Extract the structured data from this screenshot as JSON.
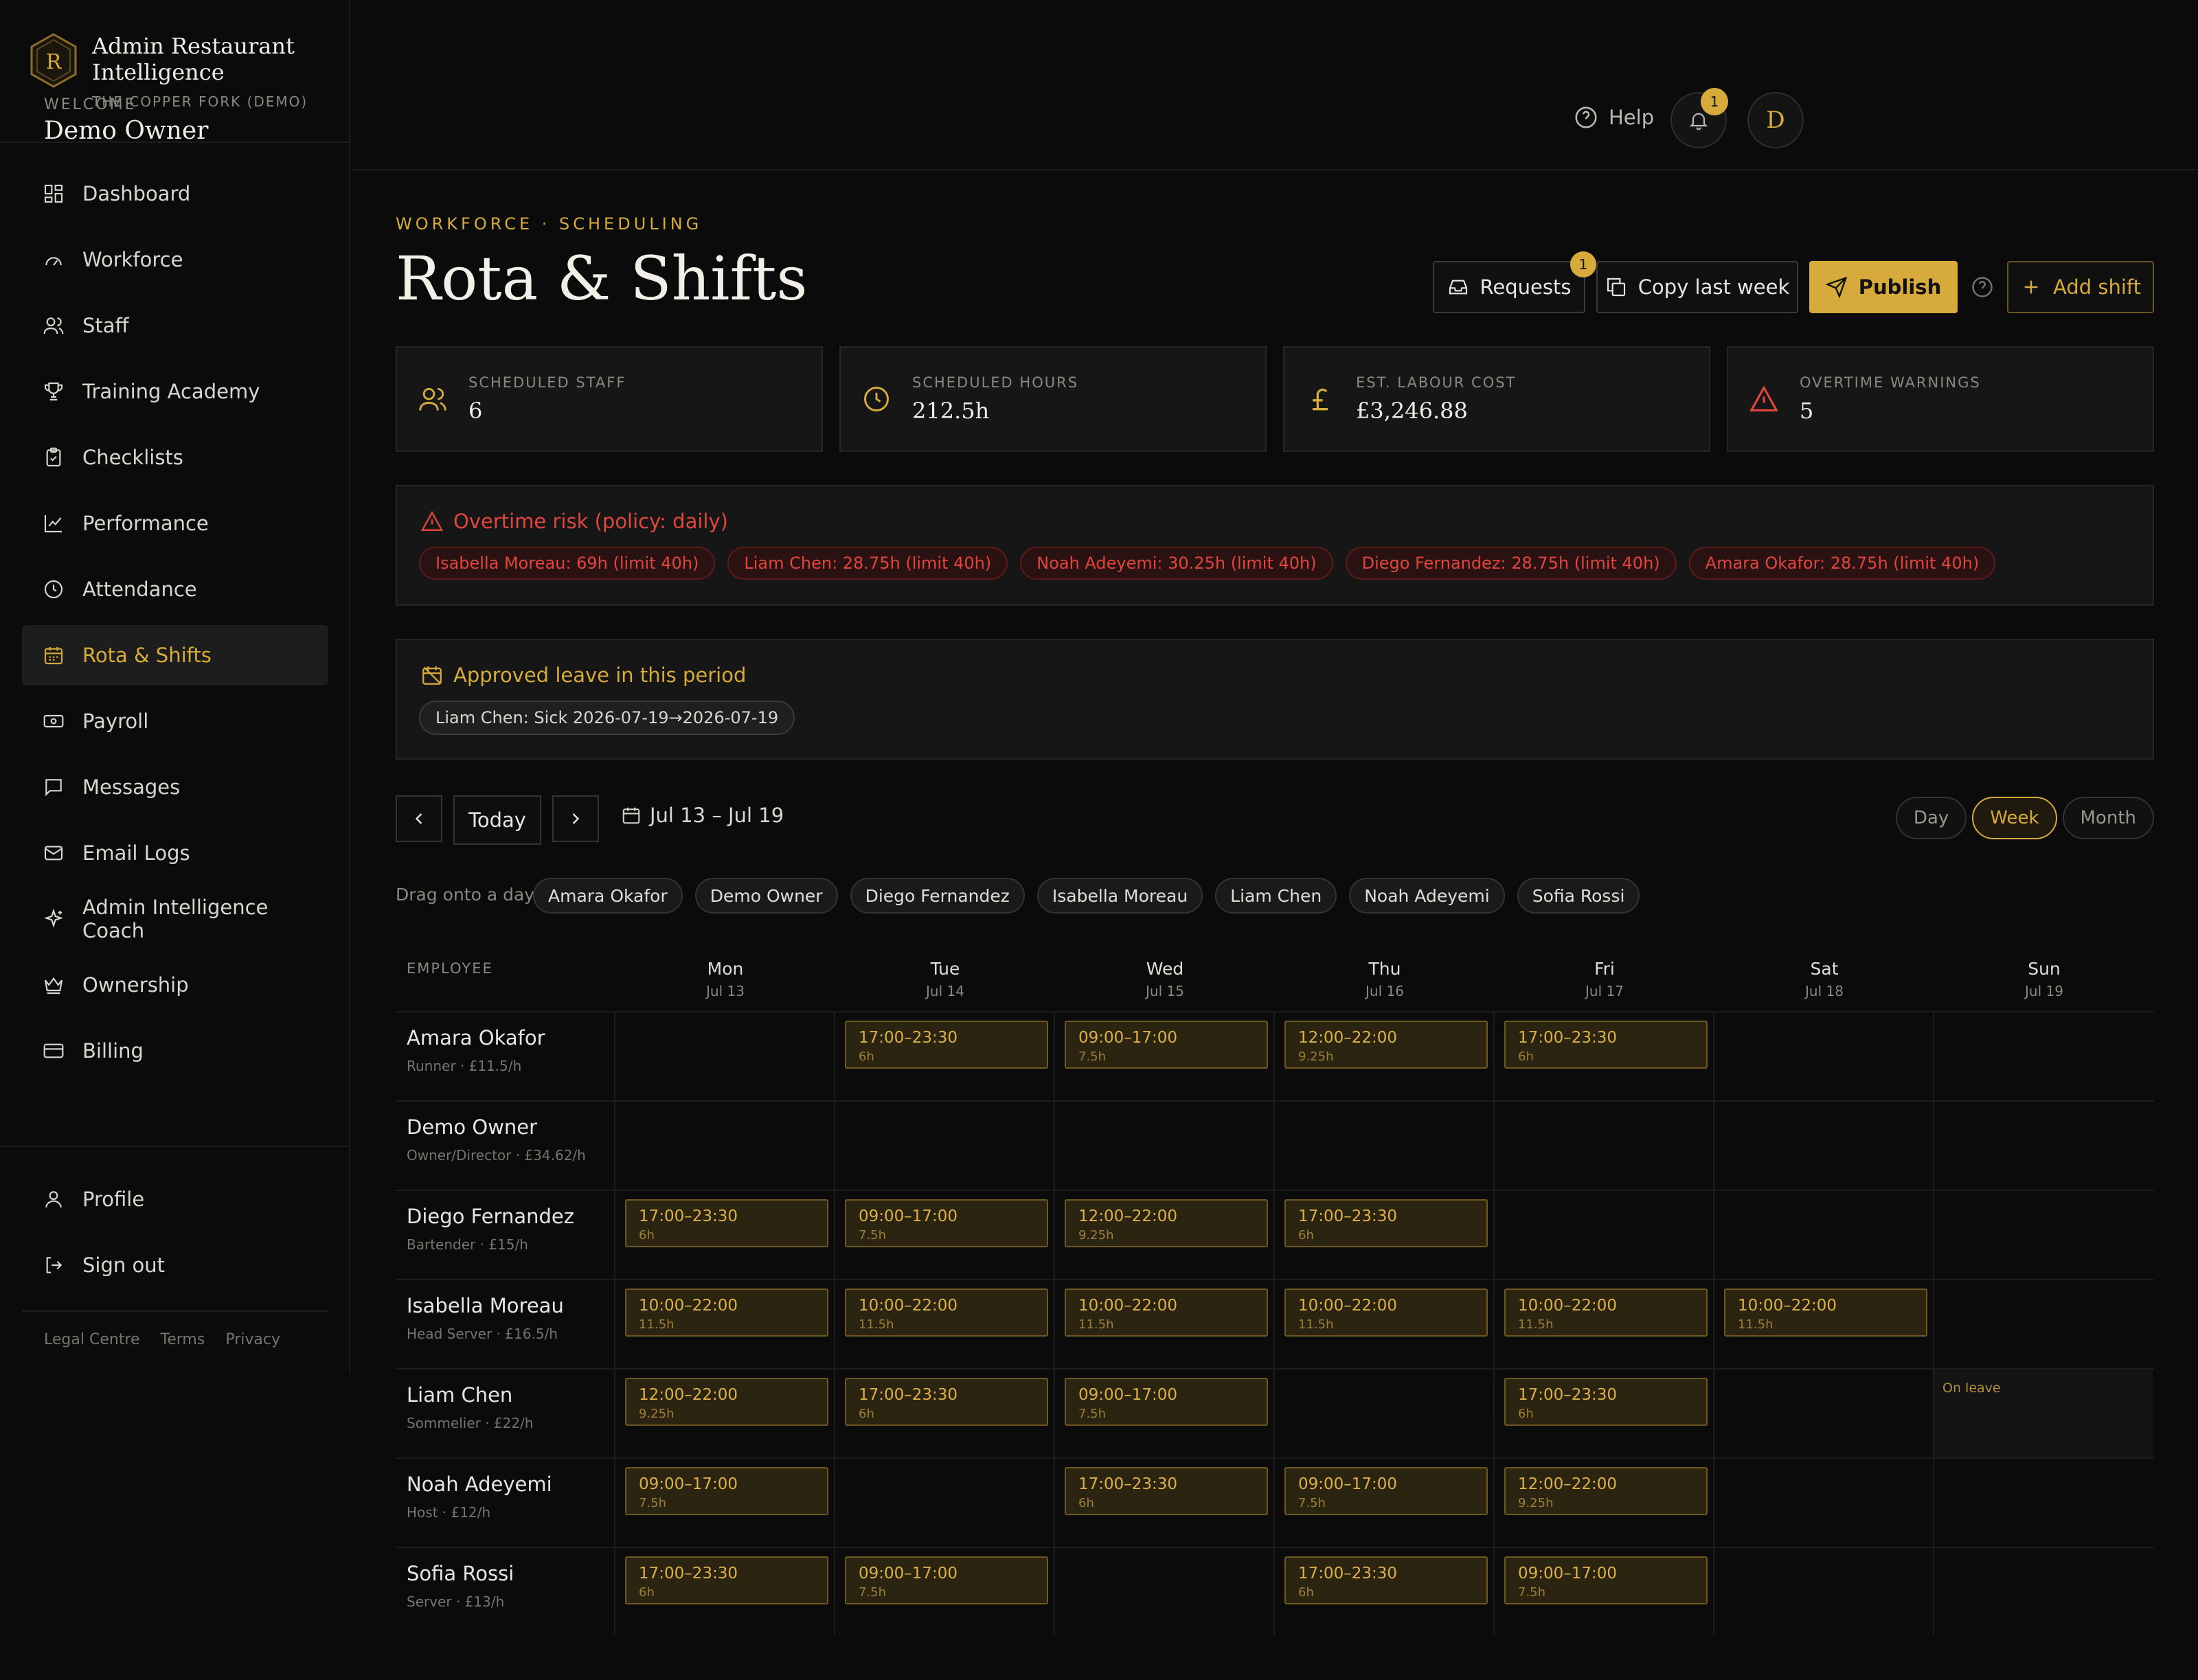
{
  "brand": {
    "title": "Admin Restaurant Intelligence",
    "subtitle": "THE COPPER FORK (DEMO)"
  },
  "nav": [
    {
      "label": "Dashboard",
      "icon": "dashboard-icon"
    },
    {
      "label": "Workforce",
      "icon": "gauge-icon"
    },
    {
      "label": "Staff",
      "icon": "users-icon"
    },
    {
      "label": "Training Academy",
      "icon": "trophy-icon"
    },
    {
      "label": "Checklists",
      "icon": "clipboard-check-icon"
    },
    {
      "label": "Performance",
      "icon": "line-chart-icon"
    },
    {
      "label": "Attendance",
      "icon": "clock-icon"
    },
    {
      "label": "Rota & Shifts",
      "icon": "calendar-icon",
      "active": true
    },
    {
      "label": "Payroll",
      "icon": "banknote-icon"
    },
    {
      "label": "Messages",
      "icon": "message-icon"
    },
    {
      "label": "Email Logs",
      "icon": "mail-icon"
    },
    {
      "label": "Admin Intelligence Coach",
      "icon": "sparkles-icon"
    },
    {
      "label": "Ownership",
      "icon": "crown-icon"
    },
    {
      "label": "Billing",
      "icon": "credit-card-icon"
    }
  ],
  "nav_bottom": [
    {
      "label": "Profile",
      "icon": "user-icon"
    },
    {
      "label": "Sign out",
      "icon": "log-out-icon"
    }
  ],
  "legal": {
    "centre": "Legal Centre",
    "terms": "Terms",
    "privacy": "Privacy"
  },
  "header": {
    "welcome_label": "WELCOME",
    "welcome_name": "Demo Owner",
    "help": "Help",
    "notif_count": "1",
    "avatar_initial": "D"
  },
  "page": {
    "eyebrow": "WORKFORCE · SCHEDULING",
    "title": "Rota & Shifts"
  },
  "actions": {
    "requests": "Requests",
    "requests_badge": "1",
    "copy": "Copy last week",
    "publish": "Publish",
    "add_shift": "Add shift"
  },
  "stats": [
    {
      "label": "SCHEDULED STAFF",
      "value": "6",
      "icon": "users-icon"
    },
    {
      "label": "SCHEDULED HOURS",
      "value": "212.5h",
      "icon": "clock-icon"
    },
    {
      "label": "EST. LABOUR COST",
      "value": "£3,246.88",
      "icon": "pound-icon"
    },
    {
      "label": "OVERTIME WARNINGS",
      "value": "5",
      "icon": "alert-triangle-icon"
    }
  ],
  "overtime": {
    "title": "Overtime risk (policy: daily)",
    "items": [
      "Isabella Moreau: 69h (limit 40h)",
      "Liam Chen: 28.75h (limit 40h)",
      "Noah Adeyemi: 30.25h (limit 40h)",
      "Diego Fernandez: 28.75h (limit 40h)",
      "Amara Okafor: 28.75h (limit 40h)"
    ]
  },
  "leave": {
    "title": "Approved leave in this period",
    "items": [
      "Liam Chen: Sick 2026-07-19→2026-07-19"
    ]
  },
  "calendar": {
    "today": "Today",
    "range": "Jul 13 – Jul 19",
    "views": [
      "Day",
      "Week",
      "Month"
    ],
    "active_view": "Week",
    "drag_label": "Drag onto a day:",
    "drag_people": [
      "Amara Okafor",
      "Demo Owner",
      "Diego Fernandez",
      "Isabella Moreau",
      "Liam Chen",
      "Noah Adeyemi",
      "Sofia Rossi"
    ],
    "employee_header": "EMPLOYEE",
    "days": [
      {
        "day": "Mon",
        "date": "Jul 13"
      },
      {
        "day": "Tue",
        "date": "Jul 14"
      },
      {
        "day": "Wed",
        "date": "Jul 15"
      },
      {
        "day": "Thu",
        "date": "Jul 16"
      },
      {
        "day": "Fri",
        "date": "Jul 17"
      },
      {
        "day": "Sat",
        "date": "Jul 18"
      },
      {
        "day": "Sun",
        "date": "Jul 19"
      }
    ],
    "leave_label": "On leave",
    "rows": [
      {
        "name": "Amara Okafor",
        "role": "Runner · £11.5/h",
        "shifts": [
          null,
          {
            "time": "17:00–23:30",
            "hours": "6h"
          },
          {
            "time": "09:00–17:00",
            "hours": "7.5h"
          },
          {
            "time": "12:00–22:00",
            "hours": "9.25h"
          },
          {
            "time": "17:00–23:30",
            "hours": "6h"
          },
          null,
          null
        ]
      },
      {
        "name": "Demo Owner",
        "role": "Owner/Director · £34.62/h",
        "shifts": [
          null,
          null,
          null,
          null,
          null,
          null,
          null
        ]
      },
      {
        "name": "Diego Fernandez",
        "role": "Bartender · £15/h",
        "shifts": [
          {
            "time": "17:00–23:30",
            "hours": "6h"
          },
          {
            "time": "09:00–17:00",
            "hours": "7.5h"
          },
          {
            "time": "12:00–22:00",
            "hours": "9.25h"
          },
          {
            "time": "17:00–23:30",
            "hours": "6h"
          },
          null,
          null,
          null
        ]
      },
      {
        "name": "Isabella Moreau",
        "role": "Head Server · £16.5/h",
        "shifts": [
          {
            "time": "10:00–22:00",
            "hours": "11.5h"
          },
          {
            "time": "10:00–22:00",
            "hours": "11.5h"
          },
          {
            "time": "10:00–22:00",
            "hours": "11.5h"
          },
          {
            "time": "10:00–22:00",
            "hours": "11.5h"
          },
          {
            "time": "10:00–22:00",
            "hours": "11.5h"
          },
          {
            "time": "10:00–22:00",
            "hours": "11.5h"
          },
          null
        ]
      },
      {
        "name": "Liam Chen",
        "role": "Sommelier · £22/h",
        "shifts": [
          {
            "time": "12:00–22:00",
            "hours": "9.25h"
          },
          {
            "time": "17:00–23:30",
            "hours": "6h"
          },
          {
            "time": "09:00–17:00",
            "hours": "7.5h"
          },
          null,
          {
            "time": "17:00–23:30",
            "hours": "6h"
          },
          null,
          "leave"
        ]
      },
      {
        "name": "Noah Adeyemi",
        "role": "Host · £12/h",
        "shifts": [
          {
            "time": "09:00–17:00",
            "hours": "7.5h"
          },
          null,
          {
            "time": "17:00–23:30",
            "hours": "6h"
          },
          {
            "time": "09:00–17:00",
            "hours": "7.5h"
          },
          {
            "time": "12:00–22:00",
            "hours": "9.25h"
          },
          null,
          null
        ]
      },
      {
        "name": "Sofia Rossi",
        "role": "Server · £13/h",
        "shifts": [
          {
            "time": "17:00–23:30",
            "hours": "6h"
          },
          {
            "time": "09:00–17:00",
            "hours": "7.5h"
          },
          null,
          {
            "time": "17:00–23:30",
            "hours": "6h"
          },
          {
            "time": "09:00–17:00",
            "hours": "7.5h"
          },
          null,
          null
        ]
      }
    ]
  },
  "colors": {
    "accent": "#d7aa3c",
    "danger": "#e0463c",
    "background": "#0b0b0b",
    "panel": "#161616"
  }
}
